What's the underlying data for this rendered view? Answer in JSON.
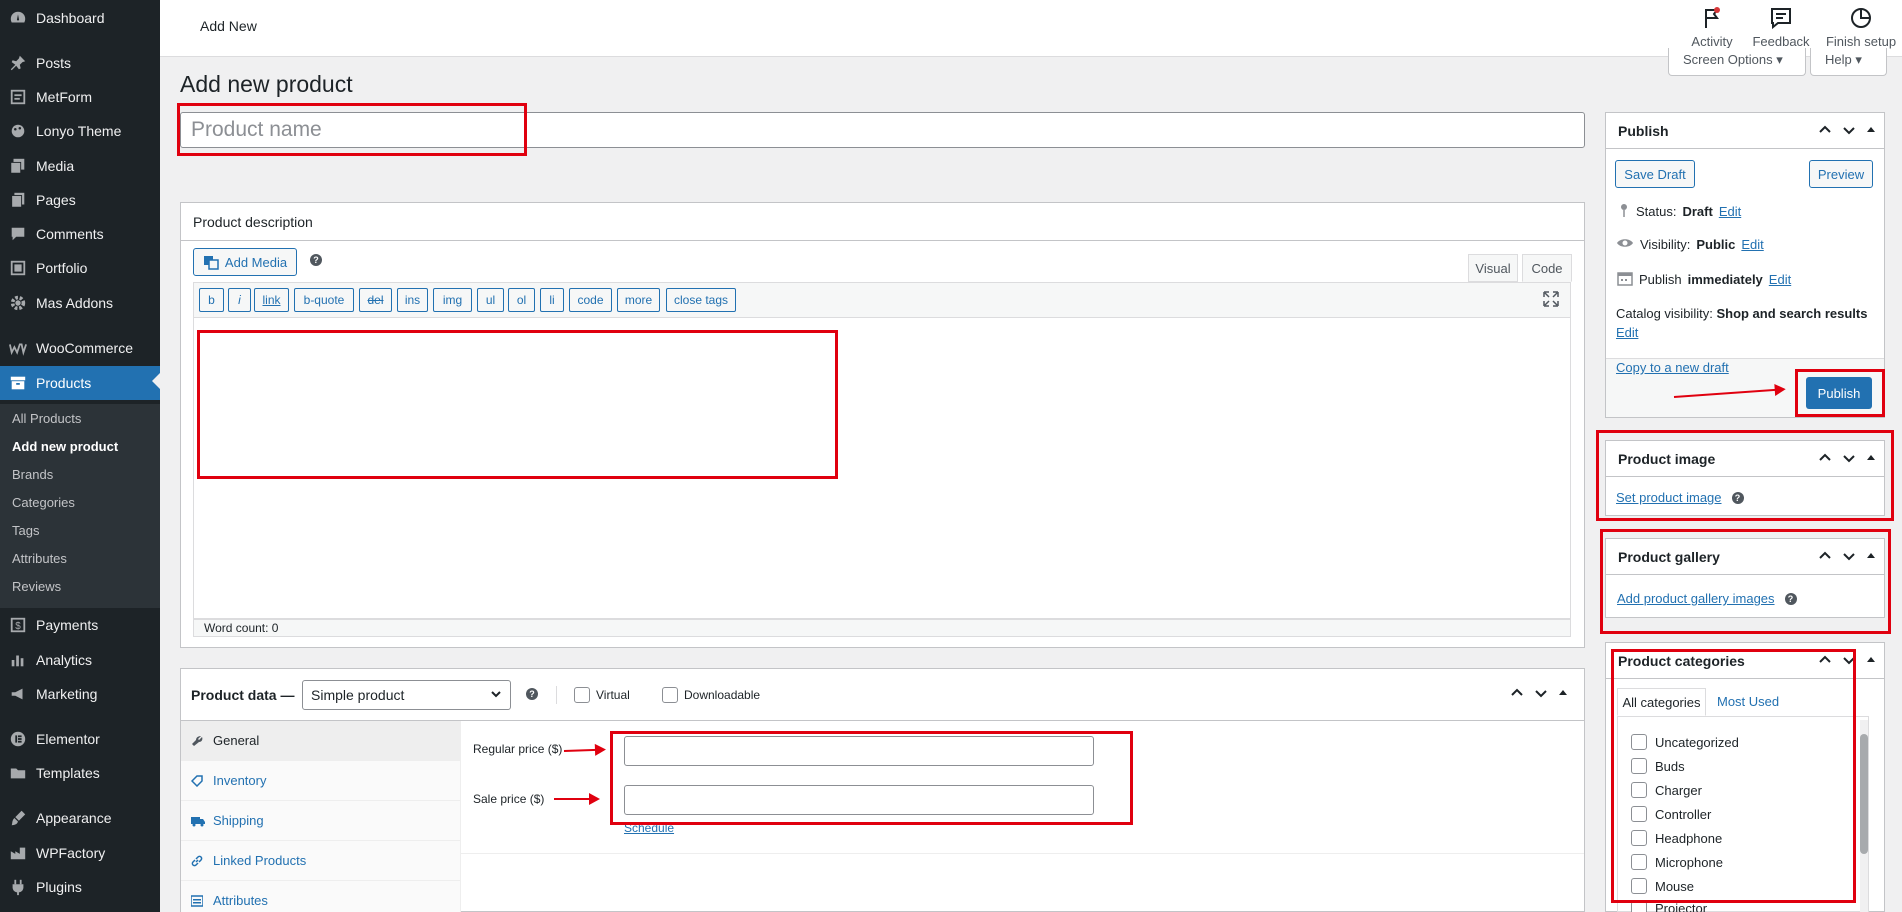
{
  "sidebar": {
    "items": [
      {
        "label": "Dashboard",
        "icon": "dashboard-icon"
      },
      {
        "label": "Posts",
        "icon": "pin-icon"
      },
      {
        "label": "MetForm",
        "icon": "form-icon"
      },
      {
        "label": "Lonyo Theme",
        "icon": "palette-icon"
      },
      {
        "label": "Media",
        "icon": "media-icon"
      },
      {
        "label": "Pages",
        "icon": "page-icon"
      },
      {
        "label": "Comments",
        "icon": "comment-icon"
      },
      {
        "label": "Portfolio",
        "icon": "portfolio-icon"
      },
      {
        "label": "Mas Addons",
        "icon": "gear-icon"
      },
      {
        "label": "WooCommerce",
        "icon": "woo-icon"
      },
      {
        "label": "Products",
        "icon": "archive-icon"
      },
      {
        "label": "Payments",
        "icon": "dollar-icon"
      },
      {
        "label": "Analytics",
        "icon": "chart-icon"
      },
      {
        "label": "Marketing",
        "icon": "megaphone-icon"
      },
      {
        "label": "Elementor",
        "icon": "elementor-icon"
      },
      {
        "label": "Templates",
        "icon": "folder-icon"
      },
      {
        "label": "Appearance",
        "icon": "brush-icon"
      },
      {
        "label": "WPFactory",
        "icon": "factory-icon"
      },
      {
        "label": "Plugins",
        "icon": "plugin-icon"
      }
    ],
    "submenu": [
      "All Products",
      "Add new product",
      "Brands",
      "Categories",
      "Tags",
      "Attributes",
      "Reviews"
    ]
  },
  "topbar": {
    "title": "Add New",
    "activity": "Activity",
    "feedback": "Feedback",
    "finish_setup": "Finish setup",
    "screen_options": "Screen Options ▾",
    "help": "Help ▾"
  },
  "page": {
    "title": "Add new product",
    "product_name_placeholder": "Product name"
  },
  "description": {
    "title": "Product description",
    "add_media": "Add Media",
    "tab_visual": "Visual",
    "tab_code": "Code",
    "quicktags": [
      "b",
      "i",
      "link",
      "b-quote",
      "del",
      "ins",
      "img",
      "ul",
      "ol",
      "li",
      "code",
      "more",
      "close tags"
    ],
    "word_count": "Word count: 0"
  },
  "product_data": {
    "title": "Product data —",
    "type_value": "Simple product",
    "virtual": "Virtual",
    "downloadable": "Downloadable",
    "tabs": [
      "General",
      "Inventory",
      "Shipping",
      "Linked Products",
      "Attributes"
    ],
    "regular_price_label": "Regular price ($)",
    "sale_price_label": "Sale price ($)",
    "schedule": "Schedule"
  },
  "publish": {
    "title": "Publish",
    "save_draft": "Save Draft",
    "preview": "Preview",
    "status_label": "Status:",
    "status_value": "Draft",
    "visibility_label": "Visibility:",
    "visibility_value": "Public",
    "publish_label": "Publish",
    "publish_value": "immediately",
    "edit": "Edit",
    "catalog_label": "Catalog visibility:",
    "catalog_value": "Shop and search results",
    "copy_draft": "Copy to a new draft",
    "publish_button": "Publish"
  },
  "product_image": {
    "title": "Product image",
    "link": "Set product image"
  },
  "product_gallery": {
    "title": "Product gallery",
    "link": "Add product gallery images"
  },
  "categories": {
    "title": "Product categories",
    "tab_all": "All categories",
    "tab_most": "Most Used",
    "items": [
      "Uncategorized",
      "Buds",
      "Charger",
      "Controller",
      "Headphone",
      "Microphone",
      "Mouse",
      "Projector"
    ]
  }
}
